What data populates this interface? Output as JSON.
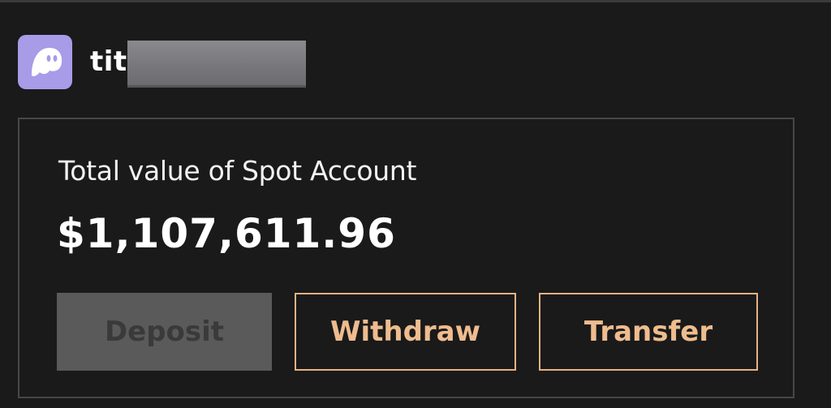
{
  "account": {
    "avatar_icon": "ghost-icon",
    "avatar_color": "#a89be8",
    "username_visible": "tit",
    "username_redacted": true
  },
  "spot_card": {
    "label": "Total value of Spot Account",
    "value": "$1,107,611.96"
  },
  "actions": {
    "deposit_label": "Deposit",
    "withdraw_label": "Withdraw",
    "transfer_label": "Transfer"
  },
  "colors": {
    "background": "#1a1a1a",
    "accent": "#eebc8e",
    "disabled_button": "#5a5a5a"
  }
}
